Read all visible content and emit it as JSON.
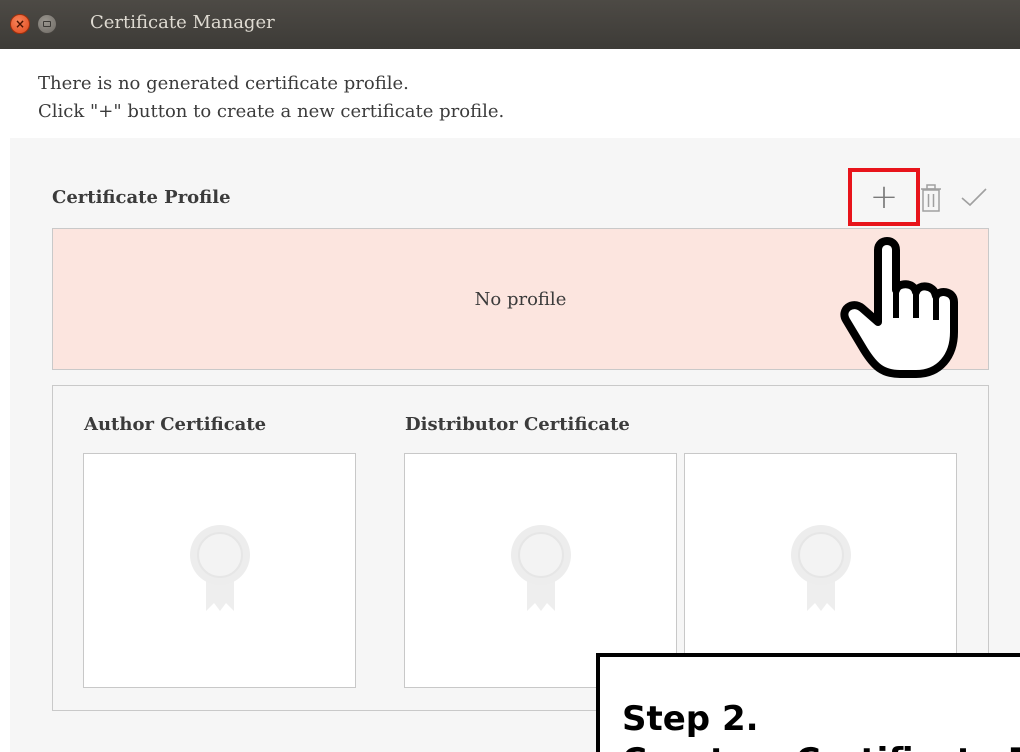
{
  "window": {
    "title": "Certificate Manager",
    "close_glyph": "×",
    "close_icon": "close-icon",
    "minimize_icon": "minimize-icon"
  },
  "intro": {
    "line1": "There is no generated certificate profile.",
    "line2": "Click \"+\" button to create a new certificate profile."
  },
  "profile": {
    "title": "Certificate Profile",
    "add_label": "+",
    "add_icon": "plus-icon",
    "delete_icon": "trash-icon",
    "confirm_icon": "checkmark-icon",
    "empty_text": "No profile"
  },
  "certificates": {
    "author_heading": "Author Certificate",
    "distributor_heading": "Distributor Certificate",
    "placeholder_icon": "certificate-badge-icon"
  },
  "annotation": {
    "highlight_color": "#e8141b",
    "step": "Step 2.",
    "description": "Create a Certificate Profile"
  },
  "colors": {
    "titlebar": "#3d3b37",
    "panel_bg": "#f6f6f6",
    "empty_box_bg": "#fce5df"
  }
}
